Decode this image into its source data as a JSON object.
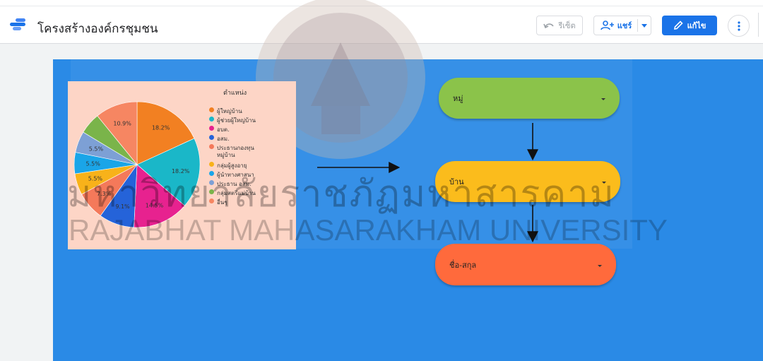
{
  "header": {
    "title": "โครงสร้างองค์กรชุมชน",
    "reset_label": "รีเซ็ต",
    "share_label": "แชร์",
    "edit_label": "แก้ไข"
  },
  "chart": {
    "legend_title": "ตำแหน่ง"
  },
  "chart_data": {
    "type": "pie",
    "title": "ตำแหน่ง",
    "categories": [
      "ผู้ใหญ่บ้าน",
      "ผู้ช่วยผู้ใหญ่บ้าน",
      "อบต.",
      "อสม.",
      "ประธานกองทุนหมู่บ้าน",
      "กลุ่มผู้สูงอายุ",
      "ผู้นำทางศาสนา",
      "ประธาน อสม.",
      "กลุ่มสตรีแม่บ้าน",
      "อื่นๆ"
    ],
    "values": [
      18.2,
      18.2,
      14.5,
      9.1,
      7.3,
      5.5,
      5.5,
      5.5,
      5.5,
      10.9
    ],
    "labels": [
      "18.2%",
      "18.2%",
      "14.5%",
      "9.1%",
      "7.3%",
      "5.5%",
      "5.5%",
      "5.5%",
      "",
      "10.9%"
    ],
    "colors": [
      "#f28022",
      "#1ab7c8",
      "#e7228f",
      "#2563d9",
      "#f4795a",
      "#f8b21a",
      "#1aa5e8",
      "#7da0d5",
      "#7ab44a",
      "#f68662"
    ],
    "legend_position": "right",
    "legend_labels": [
      "ผู้ใหญ่บ้าน",
      "ผู้ช่วยผู้ใหญ่บ้าน",
      "อบต.",
      "อสม.",
      "ประธานกองทุน",
      "หมู่บ้าน",
      "กลุ่มผู้สูงอายุ",
      "ผู้นำทางศาสนา",
      "ประธาน อสม.",
      "กลุ่มสตรีแม่บ้าน",
      "อื่นๆ"
    ]
  },
  "filters": [
    {
      "label": "หมู่",
      "color": "#8bc34a"
    },
    {
      "label": "บ้าน",
      "color": "#fbbc1c"
    },
    {
      "label": "ชื่อ-สกุล",
      "color": "#ff6a3c"
    }
  ],
  "watermark": {
    "thai": "มหาวิทยาลัยราชภัฏมหาสารคาม",
    "english": "RAJABHAT MAHASARAKHAM UNIVERSITY"
  }
}
